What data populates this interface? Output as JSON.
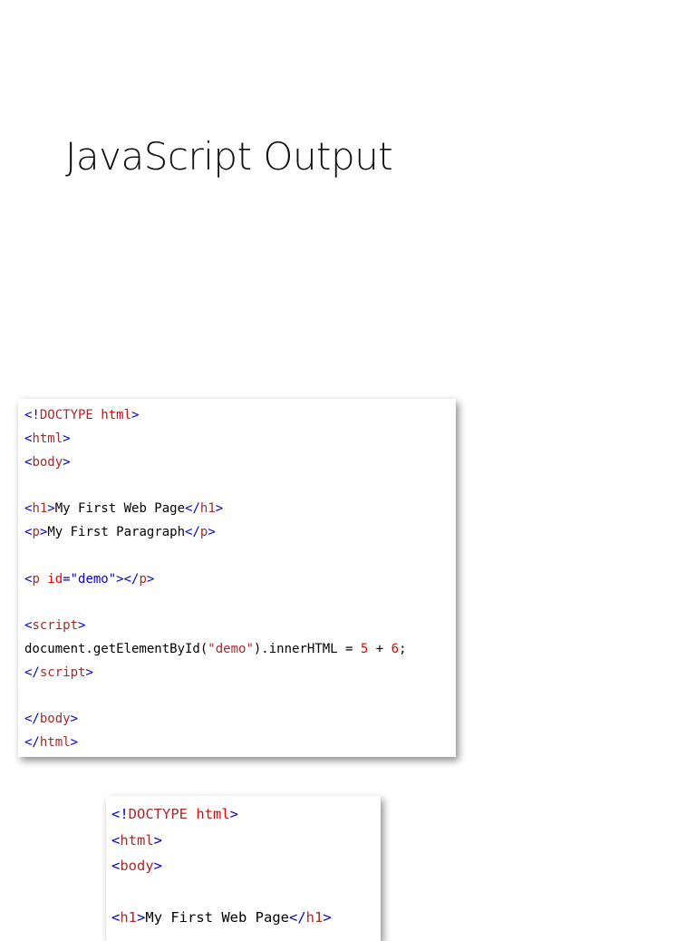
{
  "title": "JavaScript Output",
  "code_block_1": [
    [
      [
        "b",
        "<!"
      ],
      [
        "t",
        "DOCTYPE "
      ],
      [
        "a",
        "html"
      ],
      [
        "b",
        ">"
      ]
    ],
    [
      [
        "b",
        "<"
      ],
      [
        "t",
        "html"
      ],
      [
        "b",
        ">"
      ]
    ],
    [
      [
        "b",
        "<"
      ],
      [
        "t",
        "body"
      ],
      [
        "b",
        ">"
      ]
    ],
    [],
    [
      [
        "b",
        "<"
      ],
      [
        "t",
        "h1"
      ],
      [
        "b",
        ">"
      ],
      [
        "k",
        "My First Web Page"
      ],
      [
        "b",
        "</"
      ],
      [
        "t",
        "h1"
      ],
      [
        "b",
        ">"
      ]
    ],
    [
      [
        "b",
        "<"
      ],
      [
        "t",
        "p"
      ],
      [
        "b",
        ">"
      ],
      [
        "k",
        "My First Paragraph"
      ],
      [
        "b",
        "</"
      ],
      [
        "t",
        "p"
      ],
      [
        "b",
        ">"
      ]
    ],
    [],
    [
      [
        "b",
        "<"
      ],
      [
        "t",
        "p "
      ],
      [
        "a",
        "id"
      ],
      [
        "b",
        "="
      ],
      [
        "v",
        "\"demo\""
      ],
      [
        "b",
        "></"
      ],
      [
        "t",
        "p"
      ],
      [
        "b",
        ">"
      ]
    ],
    [],
    [
      [
        "b",
        "<"
      ],
      [
        "t",
        "script"
      ],
      [
        "b",
        ">"
      ]
    ],
    [
      [
        "k",
        "document.getElementById("
      ],
      [
        "t",
        "\"demo\""
      ],
      [
        "k",
        ").innerHTML = "
      ],
      [
        "n",
        "5"
      ],
      [
        "k",
        " + "
      ],
      [
        "n",
        "6"
      ],
      [
        "k",
        ";"
      ]
    ],
    [
      [
        "b",
        "</"
      ],
      [
        "t",
        "script"
      ],
      [
        "b",
        ">"
      ]
    ],
    [],
    [
      [
        "b",
        "</"
      ],
      [
        "t",
        "body"
      ],
      [
        "b",
        ">"
      ]
    ],
    [
      [
        "b",
        "</"
      ],
      [
        "t",
        "html"
      ],
      [
        "b",
        ">"
      ]
    ]
  ],
  "code_block_2": [
    [
      [
        "b",
        "<!"
      ],
      [
        "t",
        "DOCTYPE "
      ],
      [
        "a",
        "html"
      ],
      [
        "b",
        ">"
      ]
    ],
    [
      [
        "b",
        "<"
      ],
      [
        "t",
        "html"
      ],
      [
        "b",
        ">"
      ]
    ],
    [
      [
        "b",
        "<"
      ],
      [
        "t",
        "body"
      ],
      [
        "b",
        ">"
      ]
    ],
    [],
    [
      [
        "b",
        "<"
      ],
      [
        "t",
        "h1"
      ],
      [
        "b",
        ">"
      ],
      [
        "k",
        "My First Web Page"
      ],
      [
        "b",
        "</"
      ],
      [
        "t",
        "h1"
      ],
      [
        "b",
        ">"
      ]
    ]
  ]
}
